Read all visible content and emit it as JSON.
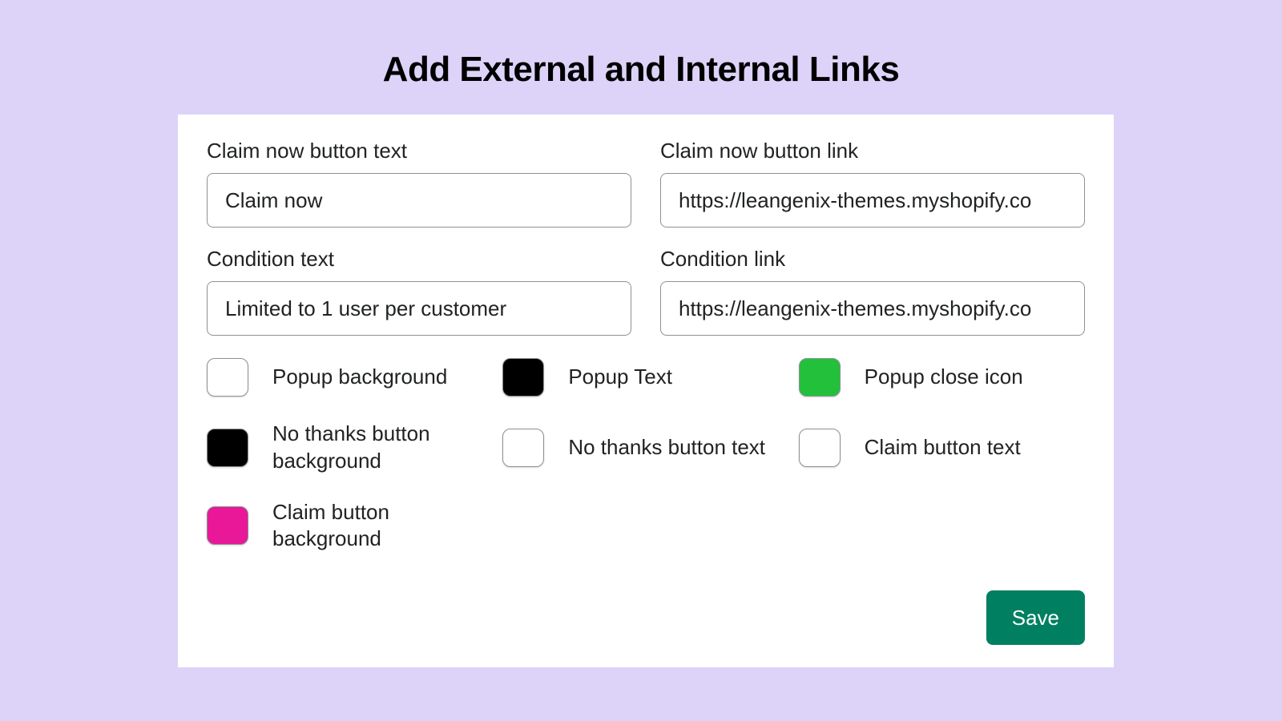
{
  "title": "Add External and Internal Links",
  "fields": {
    "claim_text": {
      "label": "Claim now button text",
      "value": "Claim now"
    },
    "claim_link": {
      "label": "Claim now button link",
      "value": "https://leangenix-themes.myshopify.co"
    },
    "condition_text": {
      "label": "Condition text",
      "value": "Limited to 1 user per customer"
    },
    "condition_link": {
      "label": "Condition link",
      "value": "https://leangenix-themes.myshopify.co"
    }
  },
  "swatches": {
    "popup_bg": {
      "label": "Popup background",
      "color": "#ffffff"
    },
    "popup_text": {
      "label": "Popup Text",
      "color": "#000000"
    },
    "popup_close": {
      "label": "Popup close icon",
      "color": "#23C03C"
    },
    "nothanks_bg": {
      "label": "No thanks button background",
      "color": "#000000"
    },
    "nothanks_text": {
      "label": "No thanks button text",
      "color": "#ffffff"
    },
    "claim_btn_text": {
      "label": "Claim button text",
      "color": "#ffffff"
    },
    "claim_btn_bg": {
      "label": "Claim button background",
      "color": "#E81899"
    }
  },
  "actions": {
    "save": "Save"
  }
}
